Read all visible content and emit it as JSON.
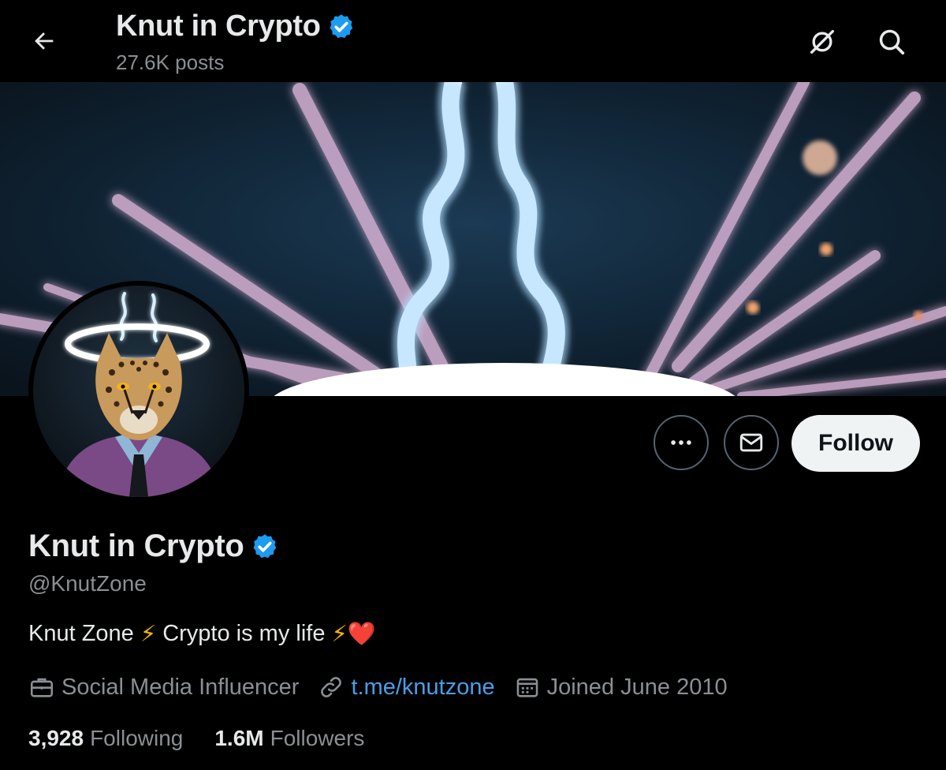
{
  "header": {
    "title": "Knut in Crypto",
    "posts": "27.6K posts"
  },
  "profile": {
    "name": "Knut in Crypto",
    "handle": "@KnutZone",
    "bio": {
      "part1": "Knut Zone",
      "emoji1": "⚡",
      "part2": "Crypto is my life",
      "emoji2": "⚡",
      "emoji3": "❤️"
    },
    "category": "Social Media Influencer",
    "link": "t.me/knutzone",
    "joined": "Joined June 2010"
  },
  "stats": {
    "following_count": "3,928",
    "following_label": "Following",
    "followers_count": "1.6M",
    "followers_label": "Followers"
  },
  "actions": {
    "follow_label": "Follow"
  },
  "icons": {
    "back": "arrow-left-icon",
    "noproxy": "no-proxy-icon",
    "search": "search-icon",
    "verified": "verified-badge-icon",
    "more": "more-dots-icon",
    "message": "envelope-icon",
    "category": "briefcase-icon",
    "link": "link-icon",
    "calendar": "calendar-icon"
  },
  "colors": {
    "background": "#000000",
    "verified": "#1d9bf0",
    "link": "#4a9ee8",
    "muted": "#8b8f94"
  }
}
